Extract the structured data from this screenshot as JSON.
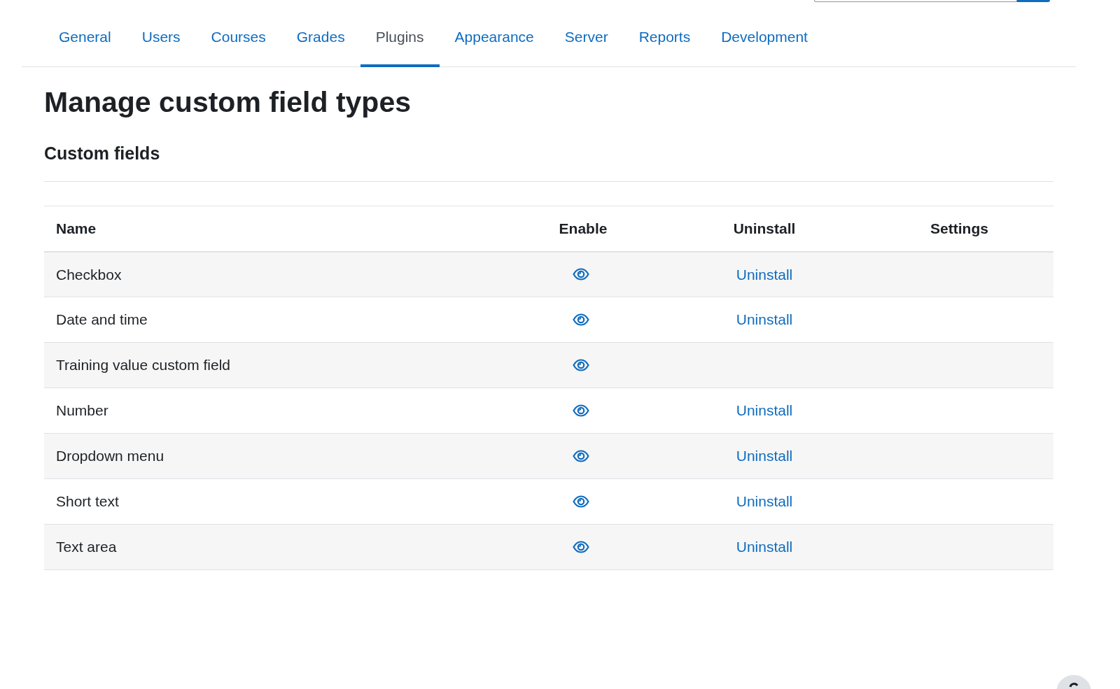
{
  "tabs": [
    {
      "label": "General",
      "selected": false
    },
    {
      "label": "Users",
      "selected": false
    },
    {
      "label": "Courses",
      "selected": false
    },
    {
      "label": "Grades",
      "selected": false
    },
    {
      "label": "Plugins",
      "selected": true
    },
    {
      "label": "Appearance",
      "selected": false
    },
    {
      "label": "Server",
      "selected": false
    },
    {
      "label": "Reports",
      "selected": false
    },
    {
      "label": "Development",
      "selected": false
    }
  ],
  "page_title": "Manage custom field types",
  "section_heading": "Custom fields",
  "table": {
    "columns": [
      "Name",
      "Enable",
      "Uninstall",
      "Settings"
    ],
    "rows": [
      {
        "name": "Checkbox",
        "enabled": true,
        "uninstall": "Uninstall"
      },
      {
        "name": "Date and time",
        "enabled": true,
        "uninstall": "Uninstall"
      },
      {
        "name": "Training value custom field",
        "enabled": true
      },
      {
        "name": "Number",
        "enabled": true,
        "uninstall": "Uninstall"
      },
      {
        "name": "Dropdown menu",
        "enabled": true,
        "uninstall": "Uninstall"
      },
      {
        "name": "Short text",
        "enabled": true,
        "uninstall": "Uninstall"
      },
      {
        "name": "Text area",
        "enabled": true,
        "uninstall": "Uninstall"
      }
    ]
  }
}
